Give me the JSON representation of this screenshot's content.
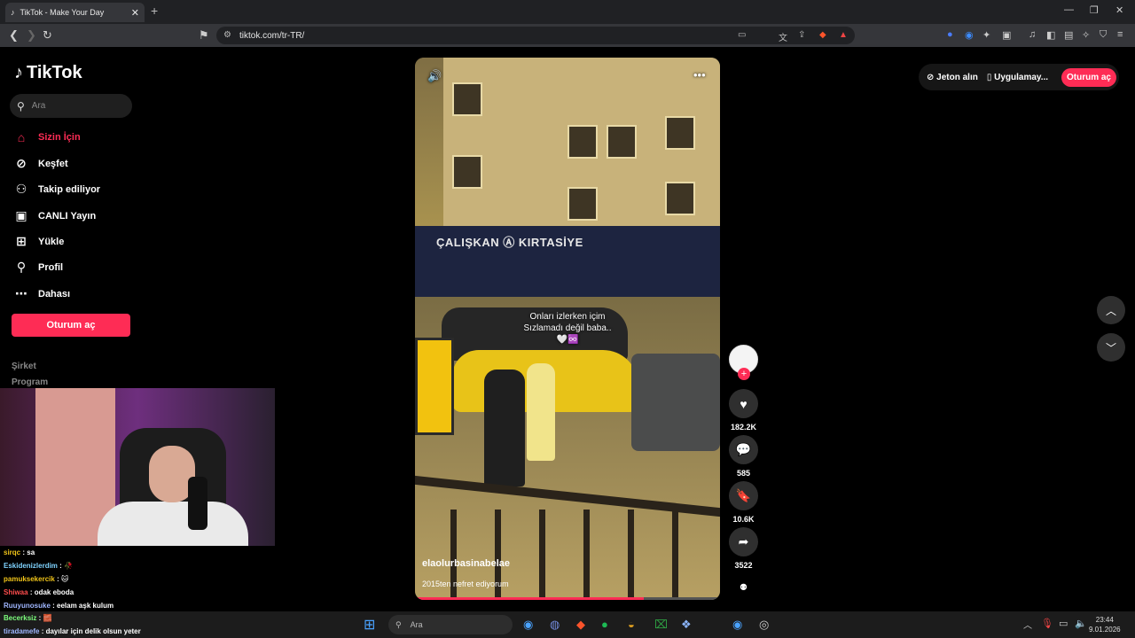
{
  "browser": {
    "tab_title": "TikTok - Make Your Day",
    "tab_close": "✕",
    "new_tab": "+",
    "url": "tiktok.com/tr-TR/",
    "window_controls": [
      "—",
      "❐",
      "✕"
    ]
  },
  "sidebar": {
    "logo": "TikTok",
    "search_placeholder": "Ara",
    "items": [
      {
        "label": "Sizin İçin",
        "icon": "home-icon",
        "glyph": "⌂",
        "active": true
      },
      {
        "label": "Keşfet",
        "icon": "compass-icon",
        "glyph": "⊘"
      },
      {
        "label": "Takip ediliyor",
        "icon": "following-icon",
        "glyph": "⚇"
      },
      {
        "label": "CANLI Yayın",
        "icon": "live-icon",
        "glyph": "▣"
      },
      {
        "label": "Yükle",
        "icon": "upload-icon",
        "glyph": "⊞"
      },
      {
        "label": "Profil",
        "icon": "profile-icon",
        "glyph": "⚲"
      },
      {
        "label": "Dahası",
        "icon": "more-icon",
        "glyph": "⋯"
      }
    ],
    "login_button": "Oturum aç",
    "footer_links": [
      "Şirket",
      "Program"
    ]
  },
  "topbar": {
    "coins": "Jeton alın",
    "app": "Uygulamay...",
    "login": "Oturum aç"
  },
  "video": {
    "overlay_line1": "Onları izlerken içim",
    "overlay_line2": "Sızlamadı değil baba..",
    "overlay_line3": "🤍♾️",
    "shop_sign": "ÇALIŞKAN  Ⓐ  KIRTASİYE",
    "username": "elaolurbasinabelae",
    "description": "2015ten nefret ediyorum",
    "progress": 0.75
  },
  "actions": {
    "likes": "182.2K",
    "comments": "585",
    "saves": "10.6K",
    "shares": "3522"
  },
  "chat": [
    {
      "user": "sirqc",
      "msg": ": sa",
      "color": "#f0c419"
    },
    {
      "user": "Eskidenizlerdim",
      "msg": ": 🥀",
      "color": "#7fd3ff"
    },
    {
      "user": "pamuksekercik",
      "msg": ": 🐱",
      "color": "#f0c419"
    },
    {
      "user": "Shiwaa",
      "msg": ": odak eboda",
      "color": "#ff4d4d"
    },
    {
      "user": "Ruuyunosuke",
      "msg": ": eelam aşk kulum",
      "color": "#9fb6ff"
    },
    {
      "user": "Becerksiz",
      "msg": ": 🧱",
      "color": "#7cfc7c"
    },
    {
      "user": "tiradamefe",
      "msg": ": dayılar için delik olsun yeter",
      "color": "#9fb6ff"
    }
  ],
  "taskbar": {
    "search": "Ara",
    "time": "23:44",
    "date": "9.01.2026"
  }
}
